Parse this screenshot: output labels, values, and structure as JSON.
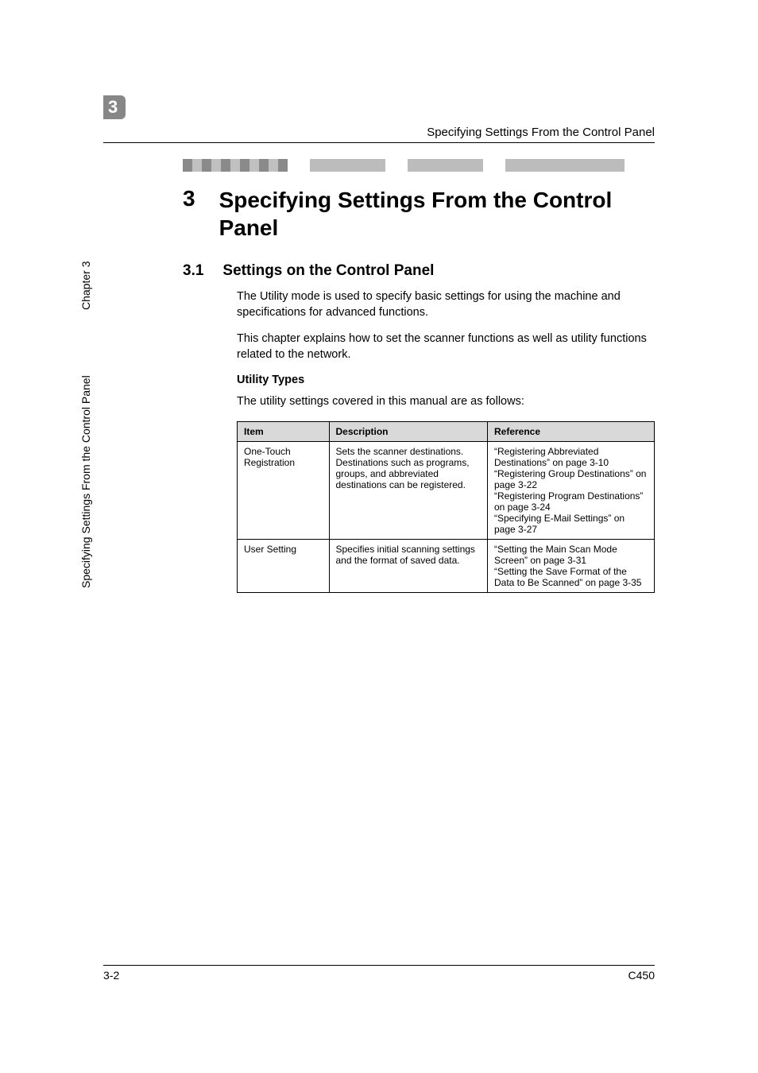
{
  "chapter_badge": "3",
  "header_title": "Specifying Settings From the Control Panel",
  "h1_num": "3",
  "h1_title": "Specifying Settings From the Control Panel",
  "h2_num": "3.1",
  "h2_title": "Settings on the Control Panel",
  "para1": "The Utility mode is used to specify basic settings for using the machine and specifications for advanced functions.",
  "para2": "This chapter explains how to set the scanner functions as well as utility functions related to the network.",
  "sub_heading": "Utility Types",
  "para3": "The utility settings covered in this manual are as follows:",
  "table": {
    "headers": [
      "Item",
      "Description",
      "Reference"
    ],
    "rows": [
      {
        "item": "One-Touch Registration",
        "desc": "Sets the scanner destinations. Destinations such as programs, groups, and abbreviated destinations can be registered.",
        "ref": "“Registering Abbreviated Destinations” on page 3-10\n“Registering Group Destinations” on page 3-22\n“Registering Program Destinations” on page 3-24\n“Specifying E-Mail Settings” on page 3-27"
      },
      {
        "item": "User Setting",
        "desc": "Specifies initial scanning settings and the format of saved data.",
        "ref": "“Setting the Main Scan Mode Screen” on page 3-31\n“Setting the Save Format of the Data to Be Scanned” on page 3-35"
      }
    ]
  },
  "sidebar_chapter": "Chapter 3",
  "sidebar_long": "Specifying Settings From the Control Panel",
  "footer_left": "3-2",
  "footer_right": "C450"
}
